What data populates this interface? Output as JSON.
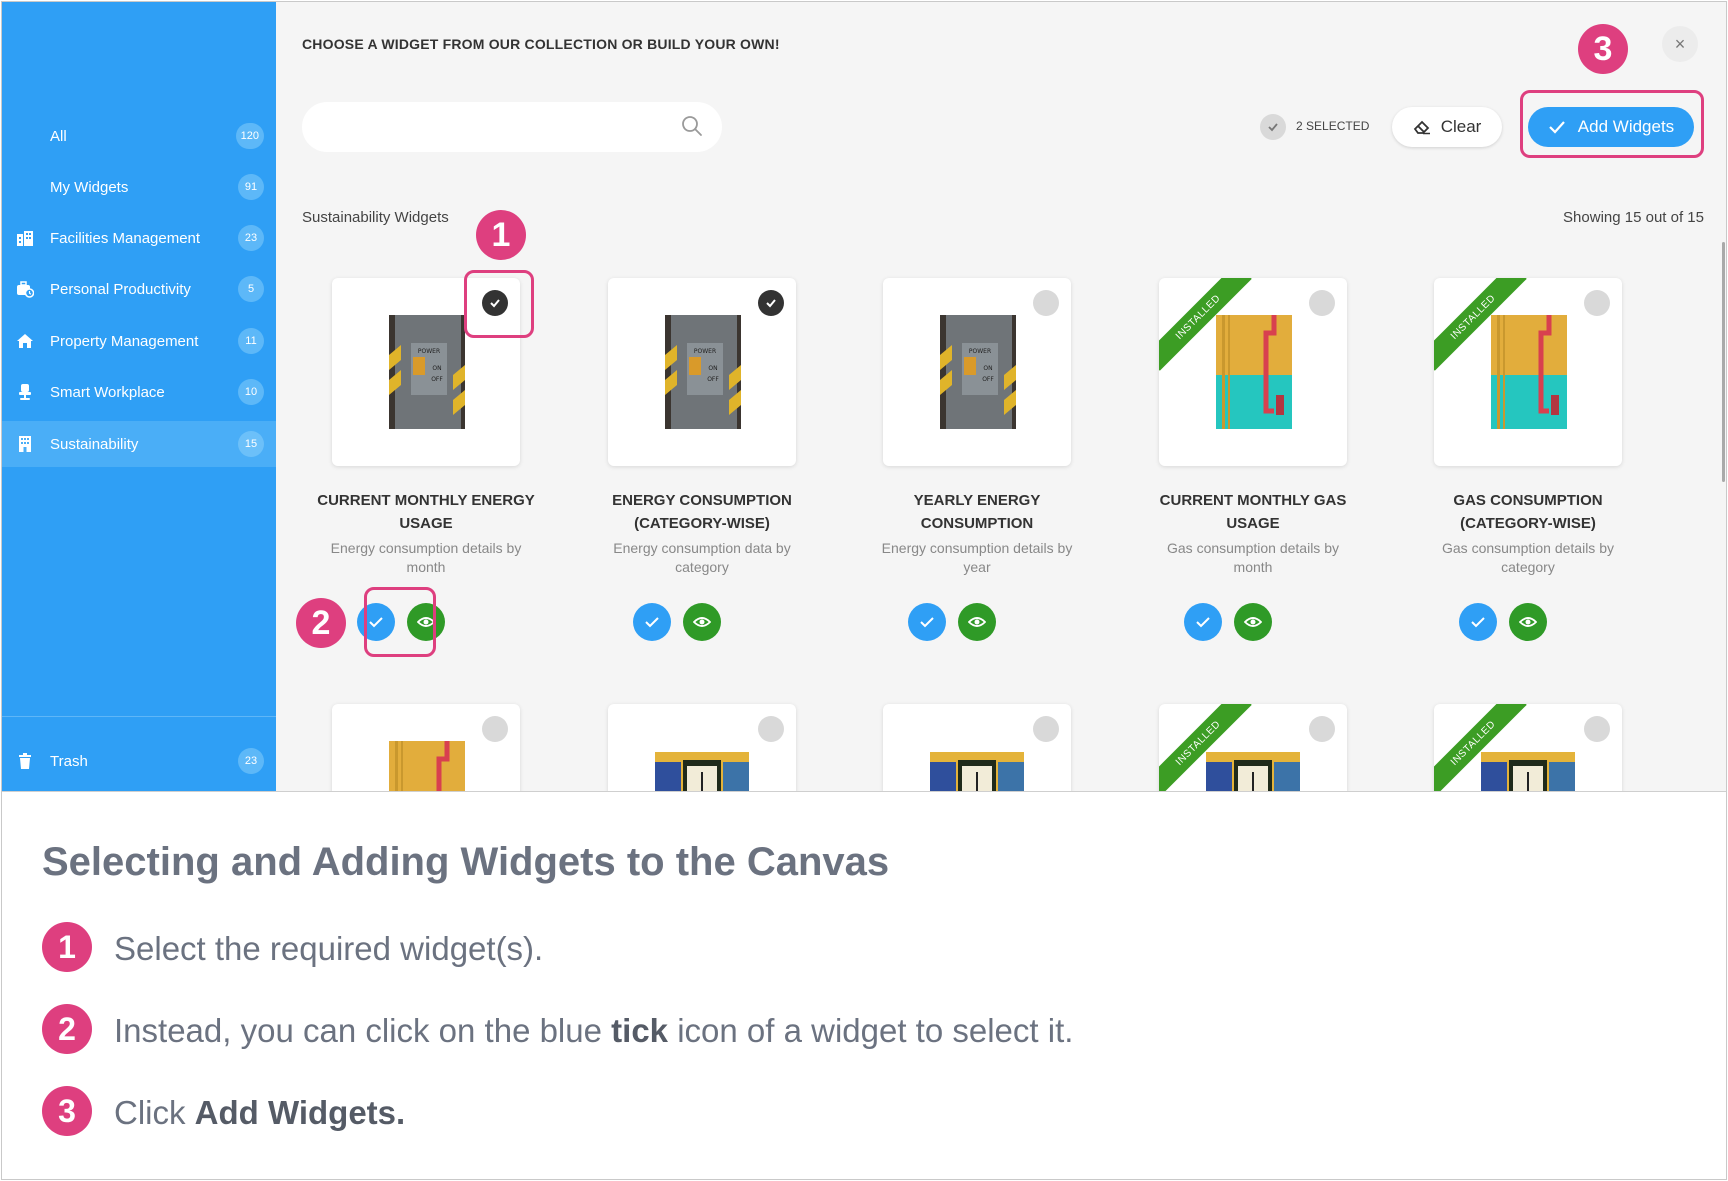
{
  "header": {
    "title": "CHOOSE A WIDGET FROM OUR COLLECTION OR BUILD YOUR OWN!",
    "close_glyph": "×"
  },
  "sidebar": {
    "items": [
      {
        "label": "All",
        "count": "120",
        "icon": ""
      },
      {
        "label": "My Widgets",
        "count": "91",
        "icon": ""
      },
      {
        "label": "Facilities Management",
        "count": "23",
        "icon": "buildings-icon"
      },
      {
        "label": "Personal Productivity",
        "count": "5",
        "icon": "briefcase-clock-icon"
      },
      {
        "label": "Property Management",
        "count": "11",
        "icon": "home-icon"
      },
      {
        "label": "Smart Workplace",
        "count": "10",
        "icon": "chair-icon"
      },
      {
        "label": "Sustainability",
        "count": "15",
        "icon": "building-icon",
        "active": true
      }
    ],
    "trash": {
      "label": "Trash",
      "count": "23",
      "icon": "trash-icon"
    }
  },
  "toolbar": {
    "search_placeholder": "",
    "selected_text": "2 SELECTED",
    "clear_label": "Clear",
    "add_label": "Add Widgets"
  },
  "section": {
    "title": "Sustainability Widgets",
    "showing": "Showing 15 out of 15"
  },
  "widgets": [
    {
      "title_line1": "CURRENT MONTHLY ENERGY",
      "title_line2": "USAGE",
      "desc_line1": "Energy consumption details by",
      "desc_line2": "month",
      "selected": true,
      "installed": false,
      "image": "power-switch"
    },
    {
      "title_line1": "ENERGY CONSUMPTION",
      "title_line2": "(CATEGORY-WISE)",
      "desc_line1": "Energy consumption data by",
      "desc_line2": "category",
      "selected": true,
      "installed": false,
      "image": "power-switch"
    },
    {
      "title_line1": "YEARLY ENERGY",
      "title_line2": "CONSUMPTION",
      "desc_line1": "Energy consumption details by",
      "desc_line2": "year",
      "selected": false,
      "installed": false,
      "image": "power-switch"
    },
    {
      "title_line1": "CURRENT MONTHLY GAS",
      "title_line2": "USAGE",
      "desc_line1": "Gas consumption details by",
      "desc_line2": "month",
      "selected": false,
      "installed": true,
      "image": "gas-pipe"
    },
    {
      "title_line1": "GAS CONSUMPTION",
      "title_line2": "(CATEGORY-WISE)",
      "desc_line1": "Gas consumption details by",
      "desc_line2": "category",
      "selected": false,
      "installed": true,
      "image": "gas-pipe"
    }
  ],
  "installed_label": "INSTALLED",
  "image_text": {
    "power": "POWER",
    "on": "ON",
    "off": "OFF"
  },
  "annotations": {
    "one": "1",
    "two": "2",
    "three": "3"
  },
  "instructions": {
    "title": "Selecting and Adding Widgets to the Canvas",
    "steps": [
      {
        "num": "1",
        "pre": "Select the required widget(s).",
        "bold": "",
        "post": ""
      },
      {
        "num": "2",
        "pre": "Instead, you can click on the blue ",
        "bold": "tick",
        "post": " icon of a widget to select it."
      },
      {
        "num": "3",
        "pre": "Click ",
        "bold": "Add Widgets.",
        "post": ""
      }
    ]
  },
  "colors": {
    "sidebar": "#2f9ff5",
    "accent": "#2f9ff5",
    "eye": "#2f9a27",
    "installed": "#3c9d24",
    "highlight": "#de3f7f"
  }
}
